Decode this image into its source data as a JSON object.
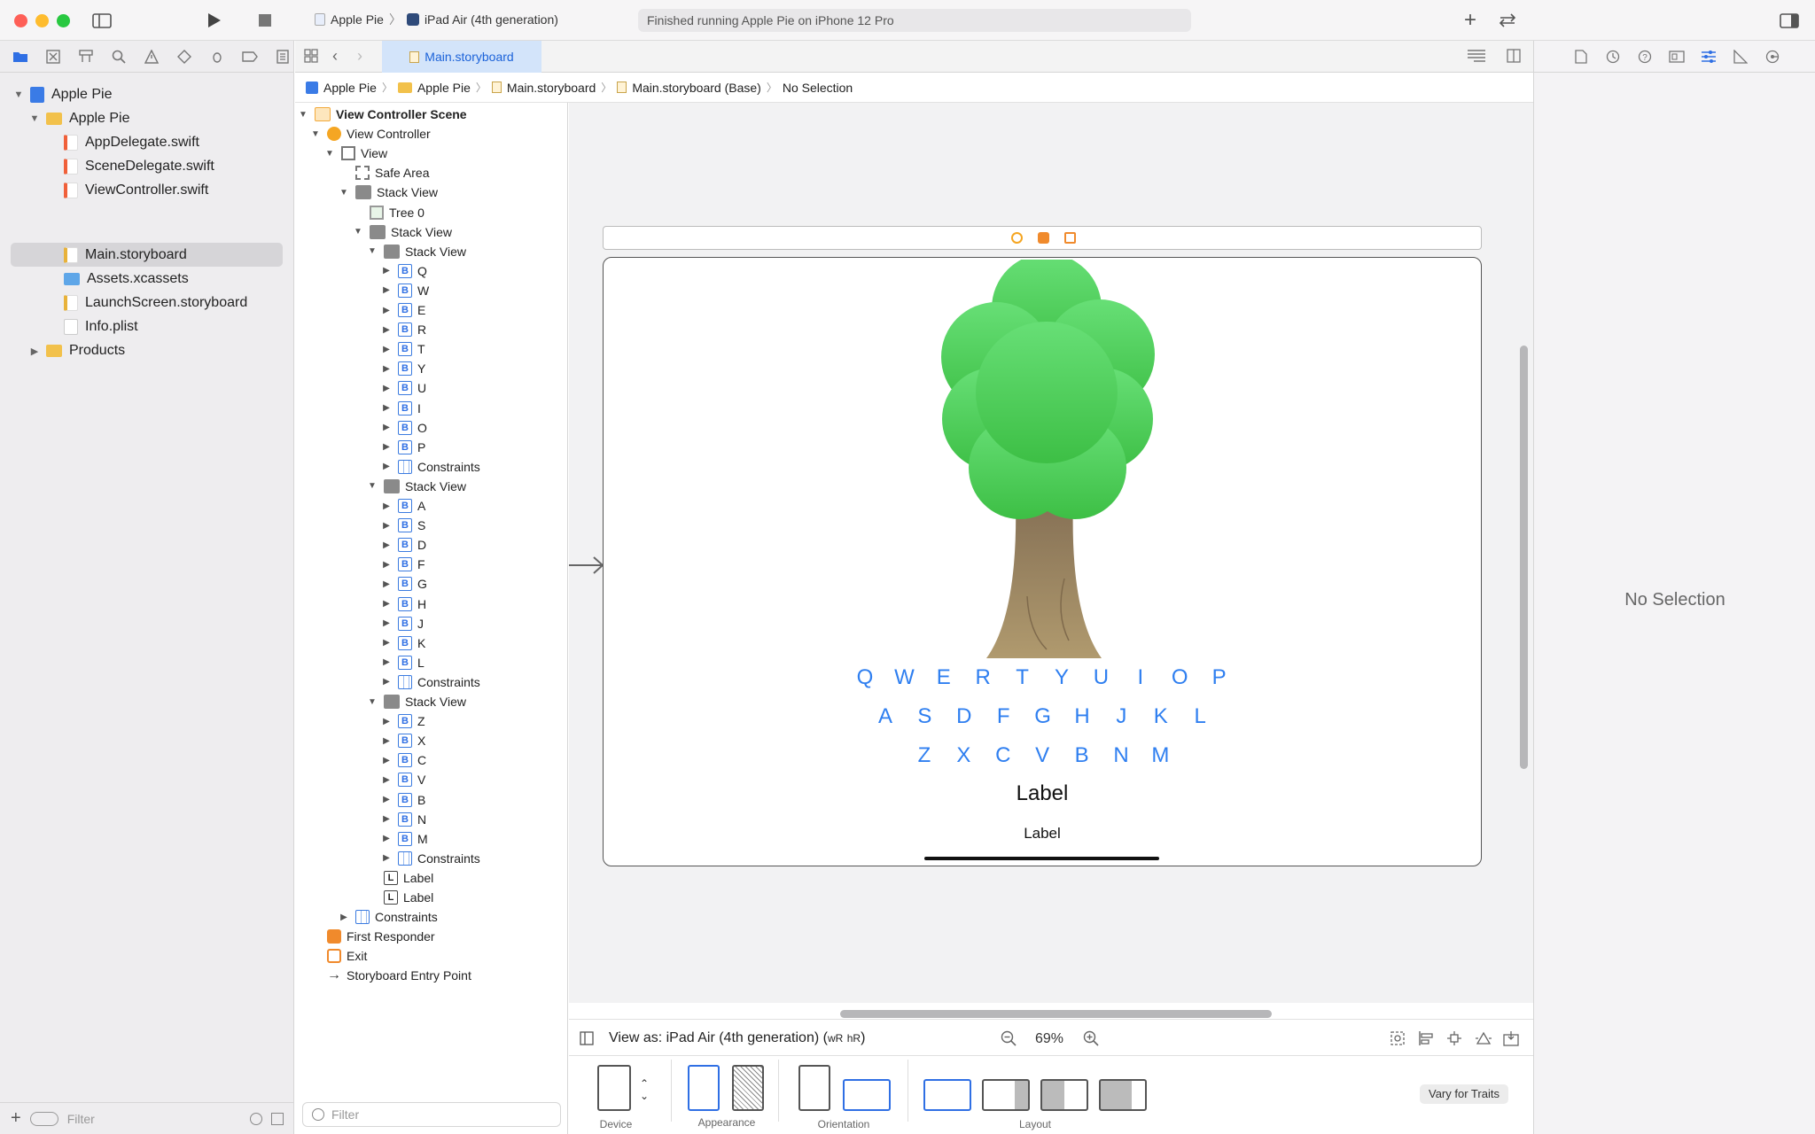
{
  "toolbar": {
    "scheme_project": "Apple Pie",
    "scheme_device": "iPad Air (4th generation)",
    "activity_status": "Finished running Apple Pie on iPhone 12 Pro"
  },
  "navigator": {
    "items": [
      {
        "label": "Apple Pie"
      },
      {
        "label": "Apple Pie"
      },
      {
        "label": "AppDelegate.swift"
      },
      {
        "label": "SceneDelegate.swift"
      },
      {
        "label": "ViewController.swift"
      },
      {
        "label": "Main.storyboard"
      },
      {
        "label": "Assets.xcassets"
      },
      {
        "label": "LaunchScreen.storyboard"
      },
      {
        "label": "Info.plist"
      },
      {
        "label": "Products"
      }
    ],
    "filter_placeholder": "Filter"
  },
  "editor": {
    "tab_label": "Main.storyboard",
    "breadcrumb": [
      "Apple Pie",
      "Apple Pie",
      "Main.storyboard",
      "Main.storyboard (Base)",
      "No Selection"
    ]
  },
  "outline": {
    "scene": "View Controller Scene",
    "view_controller": "View Controller",
    "view": "View",
    "safe_area": "Safe Area",
    "stack_view": "Stack View",
    "tree": "Tree 0",
    "constraints": "Constraints",
    "label": "Label",
    "first_responder": "First Responder",
    "exit": "Exit",
    "entry_point": "Storyboard Entry Point",
    "row1": [
      "Q",
      "W",
      "E",
      "R",
      "T",
      "Y",
      "U",
      "I",
      "O",
      "P"
    ],
    "row2": [
      "A",
      "S",
      "D",
      "F",
      "G",
      "H",
      "J",
      "K",
      "L"
    ],
    "row3": [
      "Z",
      "X",
      "C",
      "V",
      "B",
      "N",
      "M"
    ],
    "filter_placeholder": "Filter"
  },
  "canvas": {
    "keys_row1": [
      "Q",
      "W",
      "E",
      "R",
      "T",
      "Y",
      "U",
      "I",
      "O",
      "P"
    ],
    "keys_row2": [
      "A",
      "S",
      "D",
      "F",
      "G",
      "H",
      "J",
      "K",
      "L"
    ],
    "keys_row3": [
      "Z",
      "X",
      "C",
      "V",
      "B",
      "N",
      "M"
    ],
    "big_label": "Label",
    "small_label": "Label"
  },
  "viewas": {
    "text": "View as: iPad Air (4th generation) (",
    "w": "wR",
    "h": "hR",
    "close": ")",
    "zoom": "69%"
  },
  "config": {
    "device": "Device",
    "appearance": "Appearance",
    "orientation": "Orientation",
    "layout": "Layout",
    "vary_button": "Vary for Traits"
  },
  "inspector": {
    "no_selection": "No Selection"
  },
  "colors": {
    "accent": "#2f6fe4",
    "key_blue": "#2f7ff0",
    "tree_green": "#4cd060",
    "trunk": "#9c8258"
  }
}
